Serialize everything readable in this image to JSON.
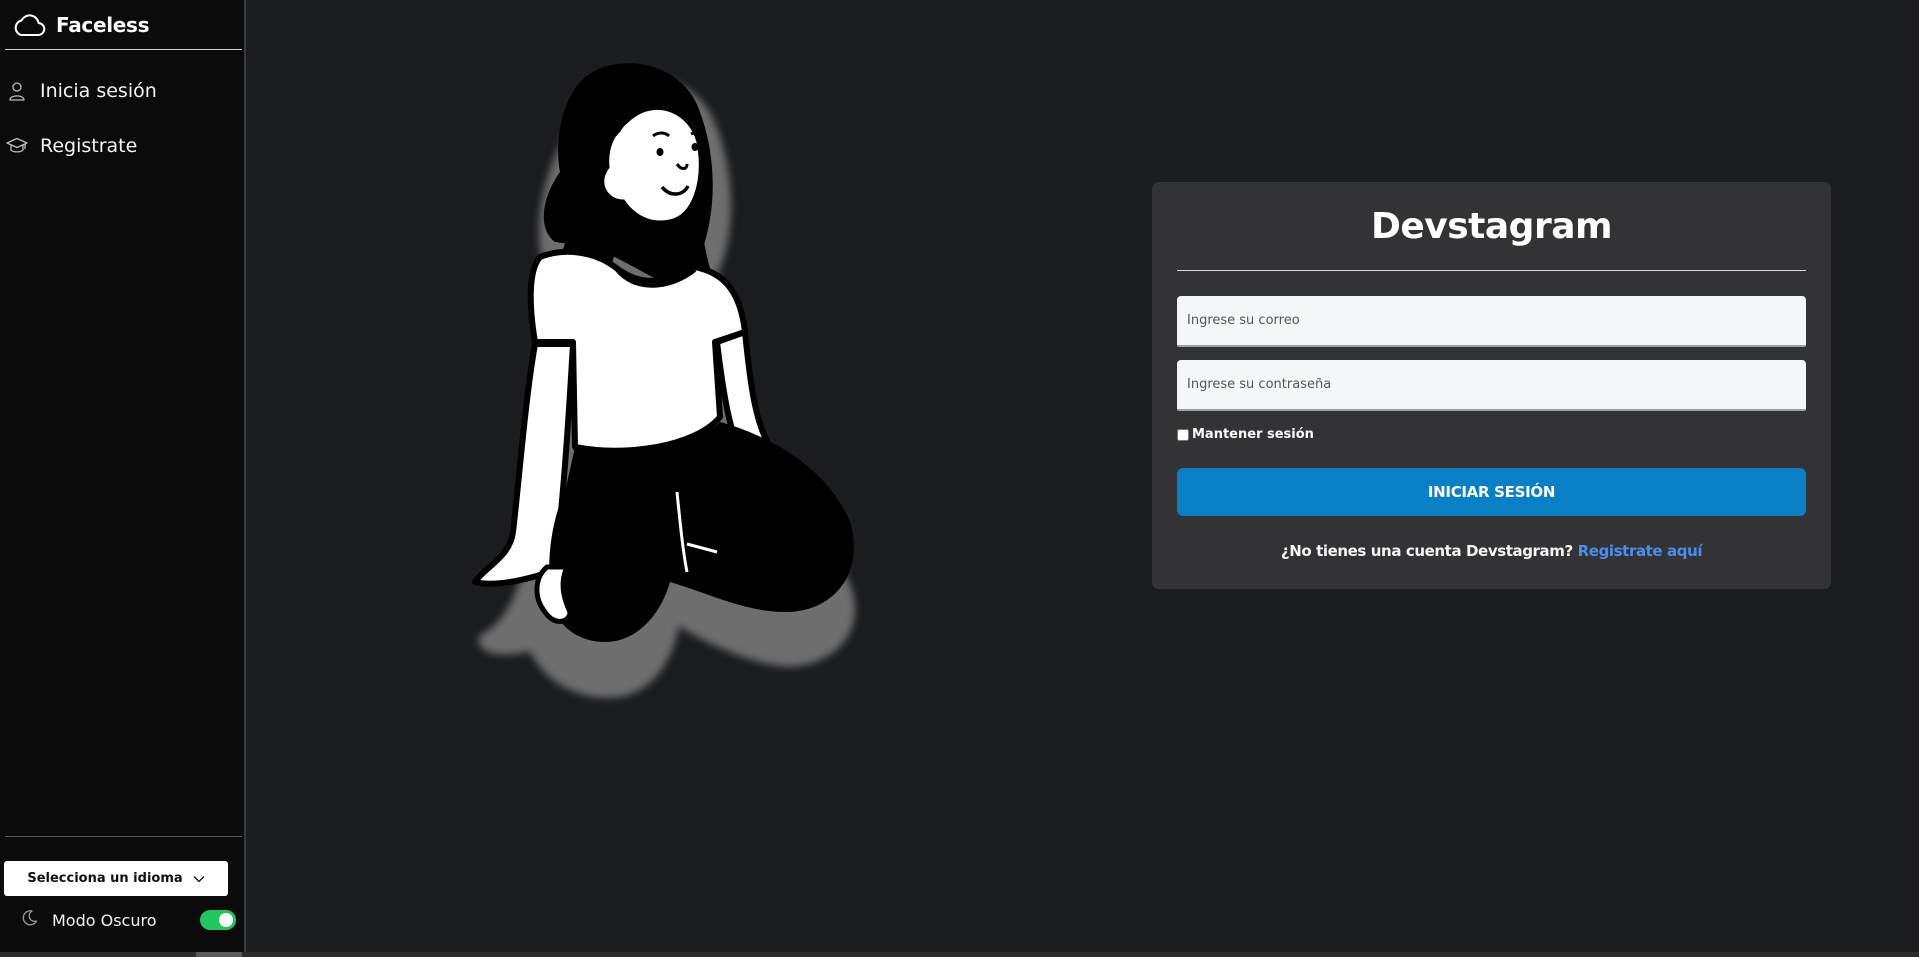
{
  "sidebar": {
    "brand": {
      "name": "Faceless",
      "icon": "cloud-icon"
    },
    "nav": [
      {
        "label": "Inicia sesión",
        "icon": "user-icon"
      },
      {
        "label": "Registrate",
        "icon": "graduation-cap-icon"
      }
    ],
    "language_select": {
      "label": "Selecciona un idioma",
      "icon": "chevron-down-icon"
    },
    "dark_mode": {
      "label": "Modo Oscuro",
      "icon": "moon-icon",
      "enabled": true
    }
  },
  "login": {
    "title": "Devstagram",
    "email_placeholder": "Ingrese su correo",
    "password_placeholder": "Ingrese su contraseña",
    "remember_label": "Mantener sesión",
    "submit_label": "INICIAR SESIÓN",
    "signup_prompt": "¿No tienes una cuenta Devstagram?",
    "signup_link": "Registrate aquí"
  },
  "colors": {
    "background": "#1b1c1e",
    "sidebar": "#0b0b0c",
    "card": "#333335",
    "primary_button": "#0a7fc6",
    "link": "#4a8ef0",
    "toggle_on": "#22c55e"
  }
}
